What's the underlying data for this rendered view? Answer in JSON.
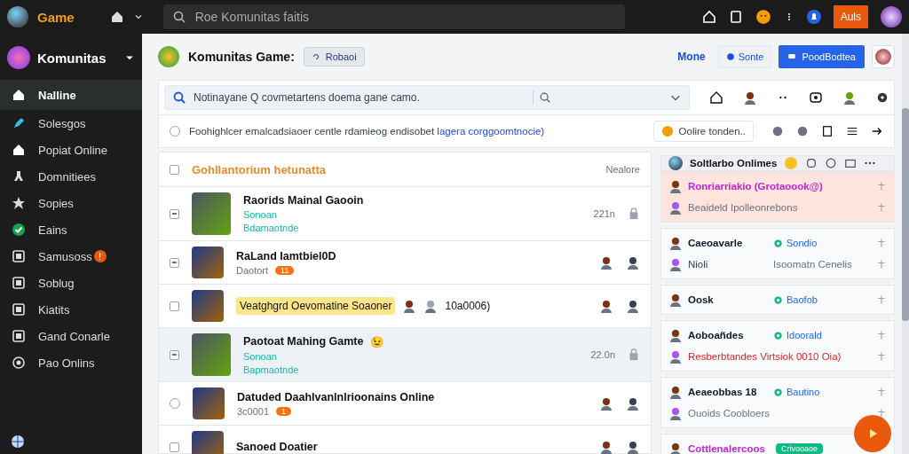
{
  "topbar": {
    "brand": "Game",
    "search_placeholder": "Roe Komunitas faitis",
    "action_button": "Auls"
  },
  "sidebar": {
    "header": "Komunitas",
    "items": [
      {
        "label": "Nalline",
        "selected": true
      },
      {
        "label": "Solesgos",
        "selected": false
      },
      {
        "label": "Popiat Online",
        "selected": false
      },
      {
        "label": "Domnitiees",
        "selected": false
      },
      {
        "label": "Sopies",
        "selected": false
      },
      {
        "label": "Eains",
        "selected": false
      },
      {
        "label": "Samusoss",
        "selected": false,
        "badge": "!"
      },
      {
        "label": "Soblug",
        "selected": false
      },
      {
        "label": "Kiatits",
        "selected": false
      },
      {
        "label": "Gand Conarle",
        "selected": false
      },
      {
        "label": "Pao Onlins",
        "selected": false
      }
    ]
  },
  "header": {
    "title": "Komunitas Game:",
    "chip": "Robaoi",
    "link": "Mone",
    "secondary_button": "Sonte",
    "primary_button": "PoodBodtea"
  },
  "filter": {
    "value": "Notinayane Q covmetartens doema gane camo."
  },
  "notice": {
    "checked": false,
    "text": "Foohighlcer emalcadsiaoer centle rdamieog endisobet ",
    "link": "lagera corggoomtnocie)",
    "button": "Oolire tonden.."
  },
  "list": {
    "all_checked": false,
    "title": "Gohllantorium hetunatta",
    "column": "Nealore",
    "rows": [
      {
        "kind": "checkbox",
        "checked": true,
        "selected": false,
        "title": "Raorids Mainal Gaooin",
        "lines": [
          "Sonoan",
          "Bdamaotnde"
        ],
        "meta": "221n"
      },
      {
        "kind": "checkbox",
        "checked": true,
        "selected": false,
        "title": "RaLand Iamtbiel0D",
        "lines": [
          "Daotort"
        ],
        "tag": "11"
      },
      {
        "kind": "checkbox",
        "checked": false,
        "selected": false,
        "title": "Veatghgrd Oevomatine Soaoner",
        "highlight": true,
        "extra": "10a0006)"
      },
      {
        "kind": "checkbox",
        "checked": true,
        "selected": true,
        "title": "Paotoat Mahing Gamte",
        "emoji": "😉",
        "lines": [
          "Sonoan",
          "Bapmaotnde"
        ],
        "meta": "22.0n"
      },
      {
        "kind": "radio",
        "checked": false,
        "selected": false,
        "title": "Datuded Daahlvanlnlrioonains Online",
        "lines": [
          "3c0001"
        ],
        "tag": "1"
      },
      {
        "kind": "checkbox",
        "checked": false,
        "selected": false,
        "title": "Sanoed Doatier"
      }
    ]
  },
  "panel": {
    "title": "Soltlarbo Onlimes",
    "groups": [
      {
        "highlighted": true,
        "rows": [
          {
            "name": "Ronriarriakio (Grotaoook@)",
            "color": "#c026d3"
          },
          {
            "name": "Beaideld Ipolleonrebons",
            "color": "#6b7280"
          }
        ]
      },
      {
        "highlighted": false,
        "rows": [
          {
            "name": "Caeoavarle",
            "color": "#111827",
            "status": "Sondio"
          },
          {
            "name": "Nioli",
            "color": "#374151",
            "note": "Isoomatn Cenelis"
          }
        ]
      },
      {
        "highlighted": false,
        "rows": [
          {
            "name": "Oosk",
            "color": "#111827",
            "status": "Baofob"
          }
        ]
      },
      {
        "highlighted": false,
        "rows": [
          {
            "name": "Aoboañdes",
            "color": "#111827",
            "status": "Idoorald"
          },
          {
            "name": "Resberbtandes Virtsiok 0010 Oia)",
            "color": "#dc2626"
          }
        ]
      },
      {
        "highlighted": false,
        "rows": [
          {
            "name": "Aeaeobbas 18",
            "color": "#111827",
            "status": "Bautino"
          },
          {
            "name": "Ouoids Coobloers",
            "color": "#6b7280"
          }
        ]
      },
      {
        "highlighted": false,
        "rows": [
          {
            "name": "Cottlenalercoos",
            "color": "#c026d3",
            "pill": "Crivooaoe"
          }
        ]
      }
    ]
  }
}
